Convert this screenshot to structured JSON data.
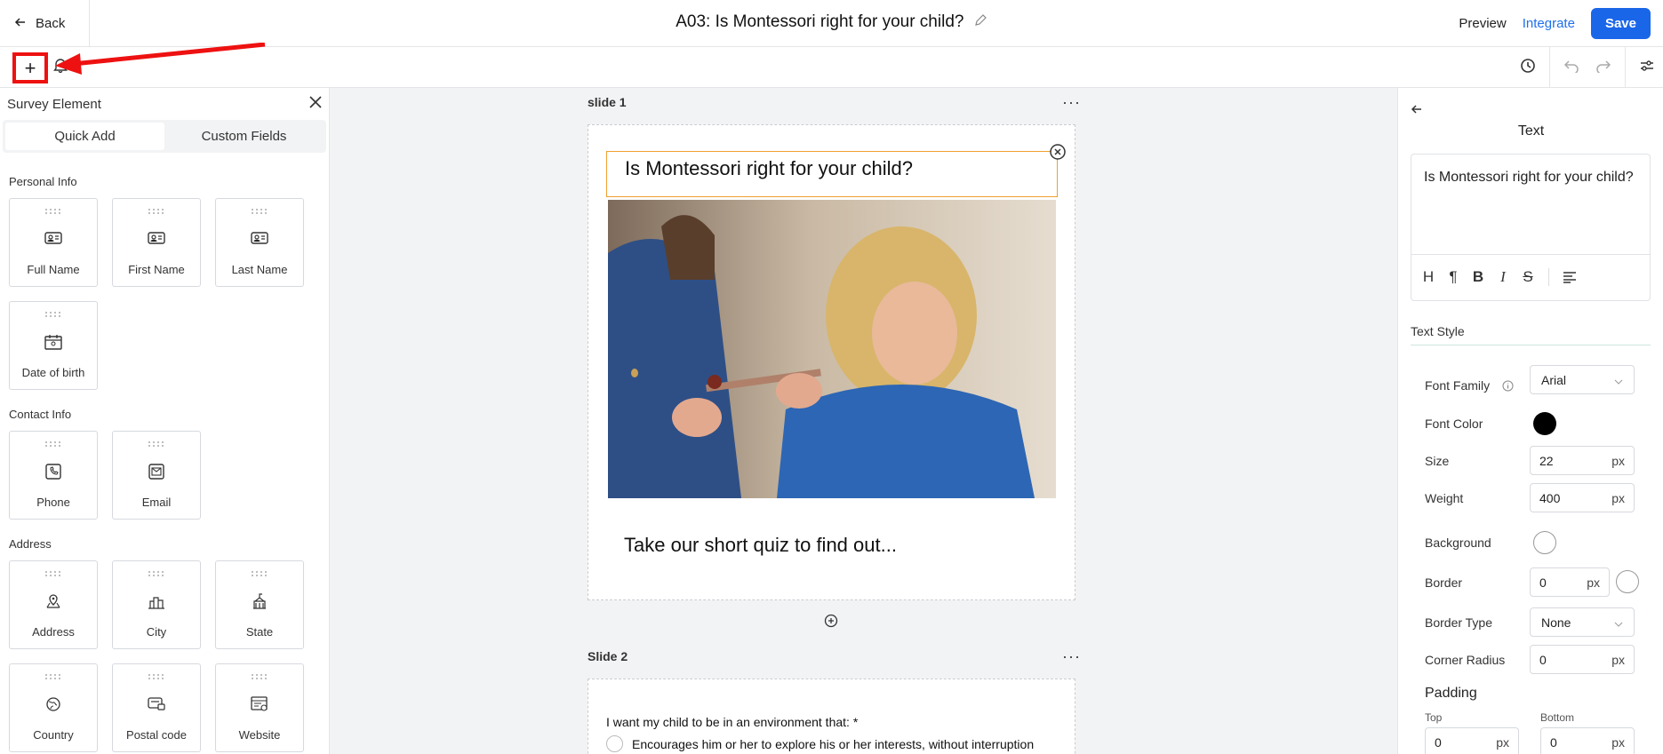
{
  "header": {
    "back_label": "Back",
    "title": "A03: Is Montessori right for your child?",
    "preview_label": "Preview",
    "integrate_label": "Integrate",
    "save_label": "Save"
  },
  "toolbar": {
    "add_icon": "plus-icon",
    "bell_icon": "bell-icon",
    "right_icons": [
      "history-icon",
      "undo-icon",
      "redo-icon",
      "settings-sliders-icon"
    ],
    "highlight_color": "#ee1111"
  },
  "left_panel": {
    "title": "Survey Element",
    "tabs": [
      {
        "label": "Quick Add",
        "active": true
      },
      {
        "label": "Custom Fields",
        "active": false
      }
    ],
    "sections": [
      {
        "title": "Personal Info",
        "items": [
          {
            "label": "Full Name",
            "icon": "id-card-icon"
          },
          {
            "label": "First Name",
            "icon": "id-card-icon"
          },
          {
            "label": "Last Name",
            "icon": "id-card-icon"
          },
          {
            "label": "Date of birth",
            "icon": "calendar-icon"
          }
        ]
      },
      {
        "title": "Contact Info",
        "items": [
          {
            "label": "Phone",
            "icon": "phone-icon"
          },
          {
            "label": "Email",
            "icon": "email-icon"
          }
        ]
      },
      {
        "title": "Address",
        "items": [
          {
            "label": "Address",
            "icon": "map-pin-icon"
          },
          {
            "label": "City",
            "icon": "city-icon"
          },
          {
            "label": "State",
            "icon": "state-building-icon"
          },
          {
            "label": "Country",
            "icon": "globe-icon"
          },
          {
            "label": "Postal code",
            "icon": "postal-icon"
          },
          {
            "label": "Website",
            "icon": "website-icon"
          }
        ]
      }
    ]
  },
  "canvas": {
    "slide1": {
      "label": "slide 1",
      "heading": "Is Montessori right for your child?",
      "subtext": "Take our short quiz to find out..."
    },
    "slide2": {
      "label": "Slide 2",
      "question": "I want my child to be in an environment that: *",
      "option1": "Encourages him or her to explore his or her interests, without interruption"
    },
    "more_label": "···"
  },
  "right_panel": {
    "title": "Text",
    "editor_text": "Is Montessori right for your child?",
    "format_buttons": [
      "heading-icon",
      "paragraph-icon",
      "bold-icon",
      "italic-icon",
      "strikethrough-icon",
      "align-left-icon"
    ],
    "section_title": "Text Style",
    "font_family_label": "Font Family",
    "font_family_value": "Arial",
    "font_color_label": "Font Color",
    "font_color_value": "#000000",
    "size_label": "Size",
    "size_value": "22",
    "weight_label": "Weight",
    "weight_value": "400",
    "background_label": "Background",
    "background_value": "#ffffff",
    "border_label": "Border",
    "border_value": "0",
    "border_type_label": "Border Type",
    "border_type_value": "None",
    "corner_radius_label": "Corner Radius",
    "corner_radius_value": "0",
    "padding_label": "Padding",
    "top_label": "Top",
    "top_value": "0",
    "bottom_label": "Bottom",
    "bottom_value": "0",
    "unit": "px"
  }
}
